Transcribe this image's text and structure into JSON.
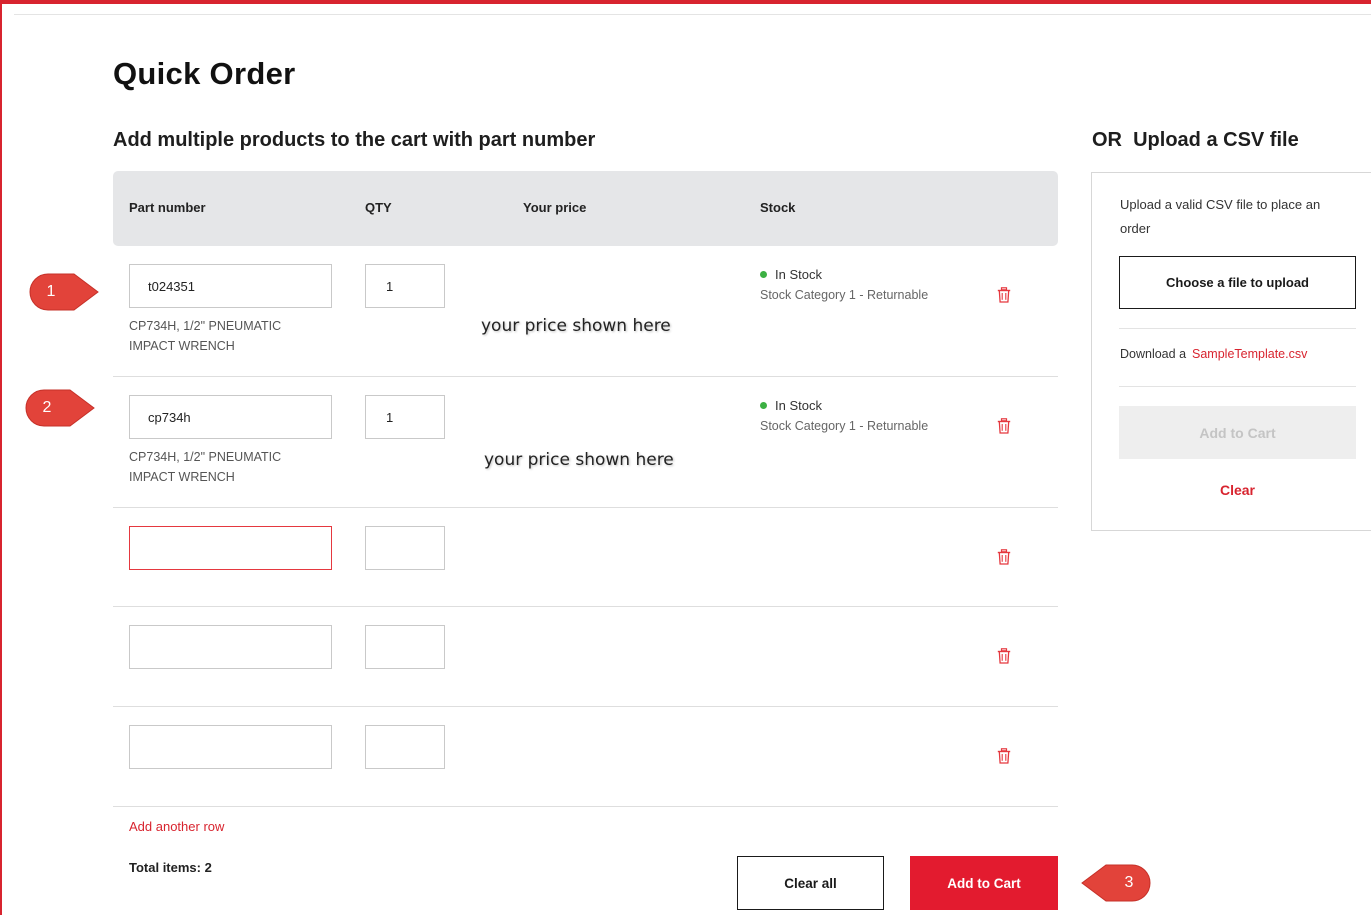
{
  "page": {
    "title": "Quick Order",
    "section_title": "Add multiple products to the cart with part number"
  },
  "table": {
    "headers": {
      "part_number": "Part number",
      "qty": "QTY",
      "your_price": "Your price",
      "stock": "Stock"
    },
    "rows": [
      {
        "part_number": "t024351",
        "qty": "1",
        "description_line1": "CP734H, 1/2\" PNEUMATIC",
        "description_line2": "IMPACT WRENCH",
        "price_note": "your price shown here",
        "stock_status": "In Stock",
        "stock_category": "Stock Category 1 - Returnable",
        "badge": "1"
      },
      {
        "part_number": "cp734h",
        "qty": "1",
        "description_line1": "CP734H, 1/2\" PNEUMATIC",
        "description_line2": "IMPACT WRENCH",
        "price_note": "your price shown here",
        "stock_status": "In Stock",
        "stock_category": "Stock Category 1 - Returnable",
        "badge": "2"
      },
      {
        "part_number": "",
        "qty": "",
        "error": true
      },
      {
        "part_number": "",
        "qty": ""
      },
      {
        "part_number": "",
        "qty": ""
      }
    ]
  },
  "footer": {
    "add_row_label": "Add another row",
    "total_label": "Total items:",
    "total_count": "2",
    "clear_all_label": "Clear all",
    "add_to_cart_label": "Add to Cart",
    "badge": "3"
  },
  "upload": {
    "title": "OR  Upload a CSV file",
    "description": "Upload a valid CSV file to place an order",
    "choose_label": "Choose a file to upload",
    "download_prefix": "Download a",
    "download_link": "SampleTemplate.csv",
    "add_to_cart_label": "Add to Cart",
    "clear_label": "Clear"
  },
  "colors": {
    "brand_red": "#e31b2f",
    "in_stock_green": "#3cb043",
    "header_gray": "#e5e6e8",
    "badge_red": "#e2433a"
  },
  "icons": {
    "delete": "trash-icon",
    "callout": "callout-badge"
  }
}
